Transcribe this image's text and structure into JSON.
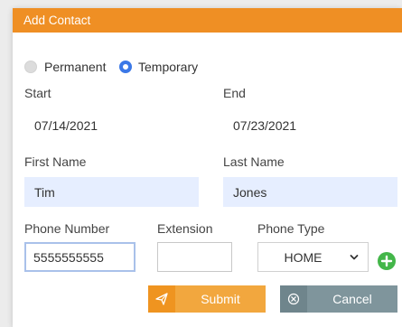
{
  "dialog": {
    "title": "Add Contact"
  },
  "contact_type": {
    "options": [
      {
        "label": "Permanent",
        "selected": false
      },
      {
        "label": "Temporary",
        "selected": true
      }
    ]
  },
  "form": {
    "start": {
      "label": "Start",
      "value": "07/14/2021"
    },
    "end": {
      "label": "End",
      "value": "07/23/2021"
    },
    "first_name": {
      "label": "First Name",
      "value": "Tim"
    },
    "last_name": {
      "label": "Last Name",
      "value": "Jones"
    },
    "phone_number": {
      "label": "Phone Number",
      "value": "5555555555"
    },
    "extension": {
      "label": "Extension",
      "value": ""
    },
    "phone_type": {
      "label": "Phone Type",
      "value": "HOME"
    }
  },
  "buttons": {
    "submit": {
      "label": "Submit",
      "icon": "send-icon"
    },
    "cancel": {
      "label": "Cancel",
      "icon": "circle-x-icon"
    },
    "add_phone": {
      "icon": "plus-circle-icon"
    }
  },
  "colors": {
    "titlebar": "#ef8f24",
    "radio_selected": "#3b78e7",
    "input_filled_bg": "#e6eeff",
    "add_button": "#43b649",
    "submit_button": "#f2a73e",
    "cancel_button": "#7f959c"
  }
}
